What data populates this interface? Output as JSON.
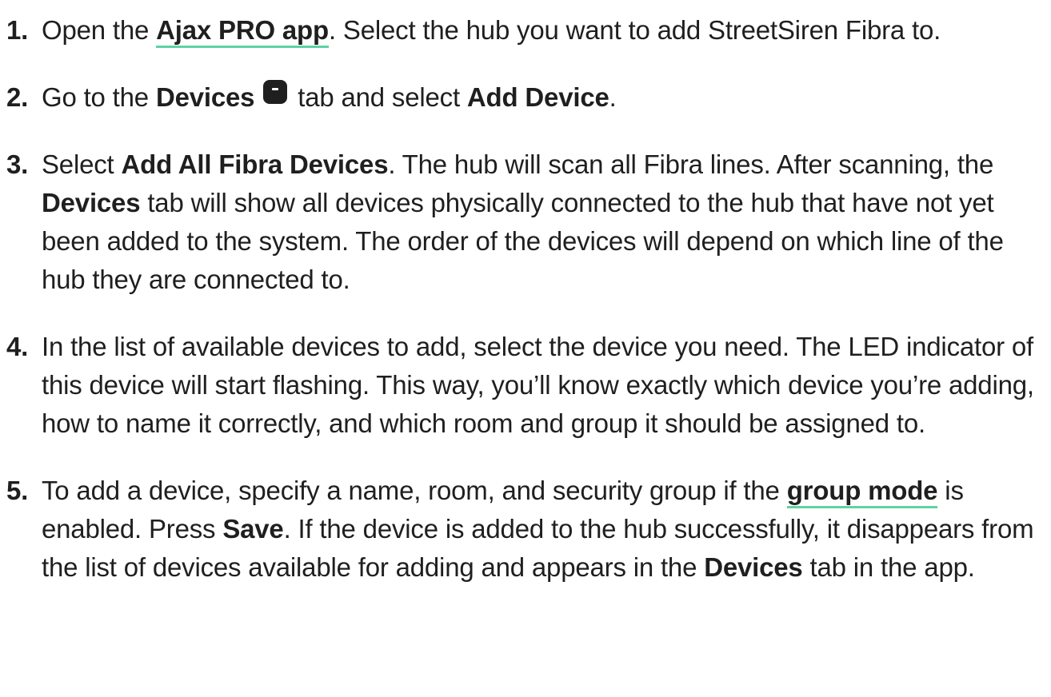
{
  "steps": [
    {
      "number": "1.",
      "t1": "Open the ",
      "link": "Ajax PRO app",
      "t2": ". Select the hub you want to add StreetSiren Fibra to."
    },
    {
      "number": "2.",
      "t1": "Go to the ",
      "b1": "Devices",
      "icon": "devices-tab-icon",
      "t2": " tab and select ",
      "b2": "Add Device",
      "t3": "."
    },
    {
      "number": "3.",
      "t1": "Select ",
      "b1": "Add All Fibra Devices",
      "t2": ". The hub will scan all Fibra lines. After scanning, the ",
      "b2": "Devices",
      "t3": " tab will show all devices physically connected to the hub that have not yet been added to the system. The order of the devices will depend on which line of the hub they are connected to."
    },
    {
      "number": "4.",
      "t1": "In the list of available devices to add, select the device you need. The LED indicator of this device will start flashing. This way, you’ll know exactly which device you’re adding, how to name it correctly, and which room and group it should be assigned to."
    },
    {
      "number": "5.",
      "t1": "To add a device, specify a name, room, and security group if the ",
      "link": "group mode",
      "t2": " is enabled. Press ",
      "b1": "Save",
      "t3": ". If the device is added to the hub successfully, it disappears from the list of devices available for adding and appears in the ",
      "b2": "Devices",
      "t4": " tab in the app."
    }
  ],
  "colors": {
    "text": "#1f1f1f",
    "link_underline": "#5fd3a3"
  }
}
